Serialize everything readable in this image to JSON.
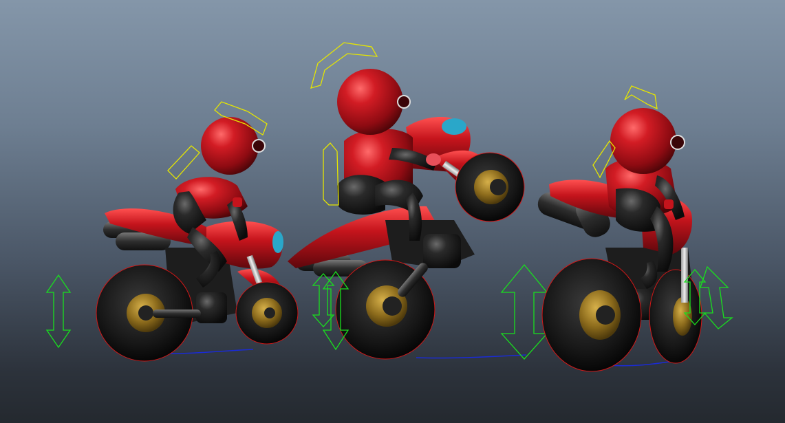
{
  "viewport": {
    "name": "3d-perspective-viewport",
    "background_top": "#8496a9",
    "background_bottom": "#24292f"
  },
  "scene": {
    "riders": [
      {
        "name": "rider-bike-left",
        "pose": "lean-back"
      },
      {
        "name": "rider-bike-center",
        "pose": "wheelie"
      },
      {
        "name": "rider-bike-right",
        "pose": "rear-view-lean"
      }
    ],
    "colors": {
      "body_red": "#b3121b",
      "helmet_red": "#c4141d",
      "tire_black": "#151515",
      "rim_gold": "#9a7a22",
      "control_yellow": "#e6e600",
      "control_green": "#19e01e",
      "ground_blue": "#1a2bd6",
      "visor_cyan": "#2aa7c9"
    },
    "icons": [
      "suspension-arrow-control-icon",
      "head-arc-control-icon",
      "ground-path-curve-icon"
    ]
  }
}
